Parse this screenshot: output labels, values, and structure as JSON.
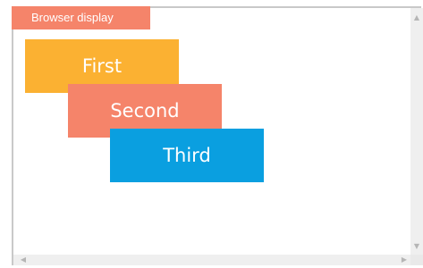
{
  "display": {
    "tag_label": "Browser display"
  },
  "boxes": [
    {
      "label": "First",
      "color": "#fbb132"
    },
    {
      "label": "Second",
      "color": "#f5846a"
    },
    {
      "label": "Third",
      "color": "#0a9fe0"
    }
  ],
  "scrollbars": {
    "up_icon": "▲",
    "down_icon": "▼",
    "left_icon": "◀",
    "right_icon": "▶"
  }
}
